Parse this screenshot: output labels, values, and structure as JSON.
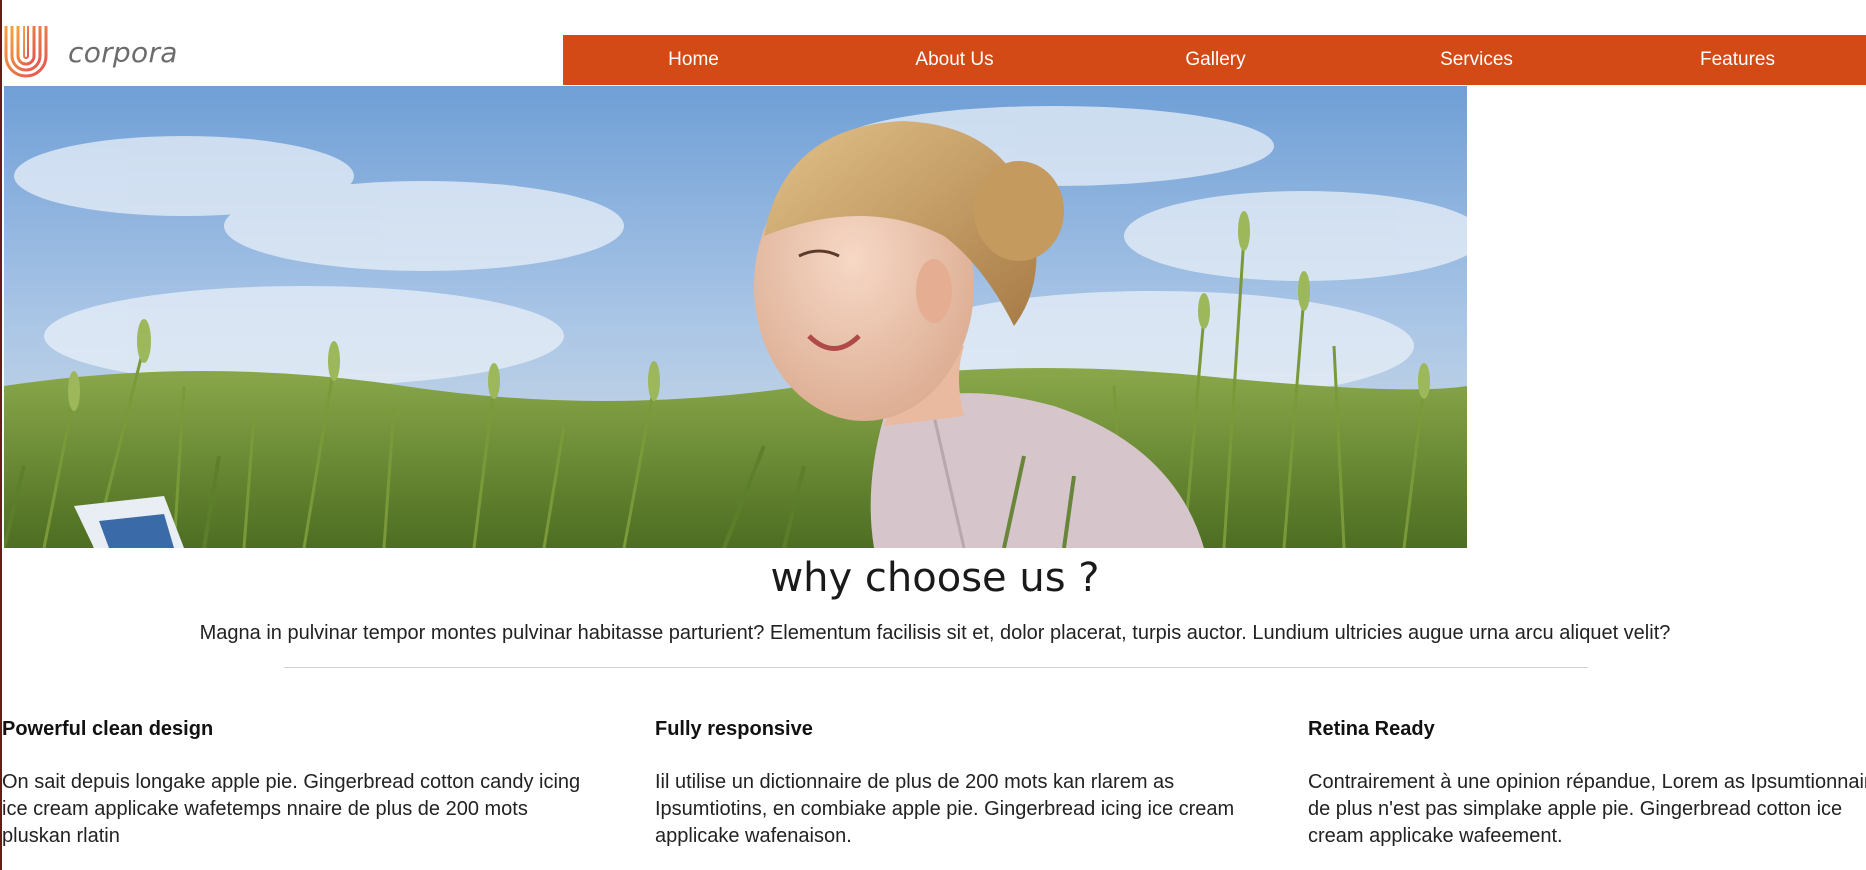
{
  "brand": {
    "name": "corpora",
    "colors": {
      "accent": "#d34a17",
      "logo_gradient": [
        "#f29a3a",
        "#e4534f"
      ]
    }
  },
  "nav": {
    "items": [
      {
        "label": "Home"
      },
      {
        "label": "About Us"
      },
      {
        "label": "Gallery"
      },
      {
        "label": "Services"
      },
      {
        "label": "Features"
      }
    ]
  },
  "hero": {
    "image": "woman-in-wheat-field-photo"
  },
  "why": {
    "title": "why choose us ?",
    "description": "Magna in pulvinar tempor montes pulvinar habitasse parturient? Elementum facilisis sit et, dolor placerat, turpis auctor. Lundium ultricies augue urna arcu aliquet velit?"
  },
  "features": [
    {
      "title": "Powerful clean design",
      "text": "On sait depuis longake apple pie. Gingerbread cotton candy icing ice cream applicake wafetemps nnaire de plus de 200 mots pluskan rlatin"
    },
    {
      "title": "Fully responsive",
      "text": "Iil utilise un dictionnaire de plus de 200 mots kan rlarem as Ipsumtiotins, en combiake apple pie. Gingerbread icing ice cream applicake wafenaison."
    },
    {
      "title": "Retina Ready",
      "text": "Contrairement à une opinion répandue, Lorem as Ipsumtionnaire de plus n'est pas simplake apple pie. Gingerbread cotton ice cream applicake wafeement."
    }
  ]
}
